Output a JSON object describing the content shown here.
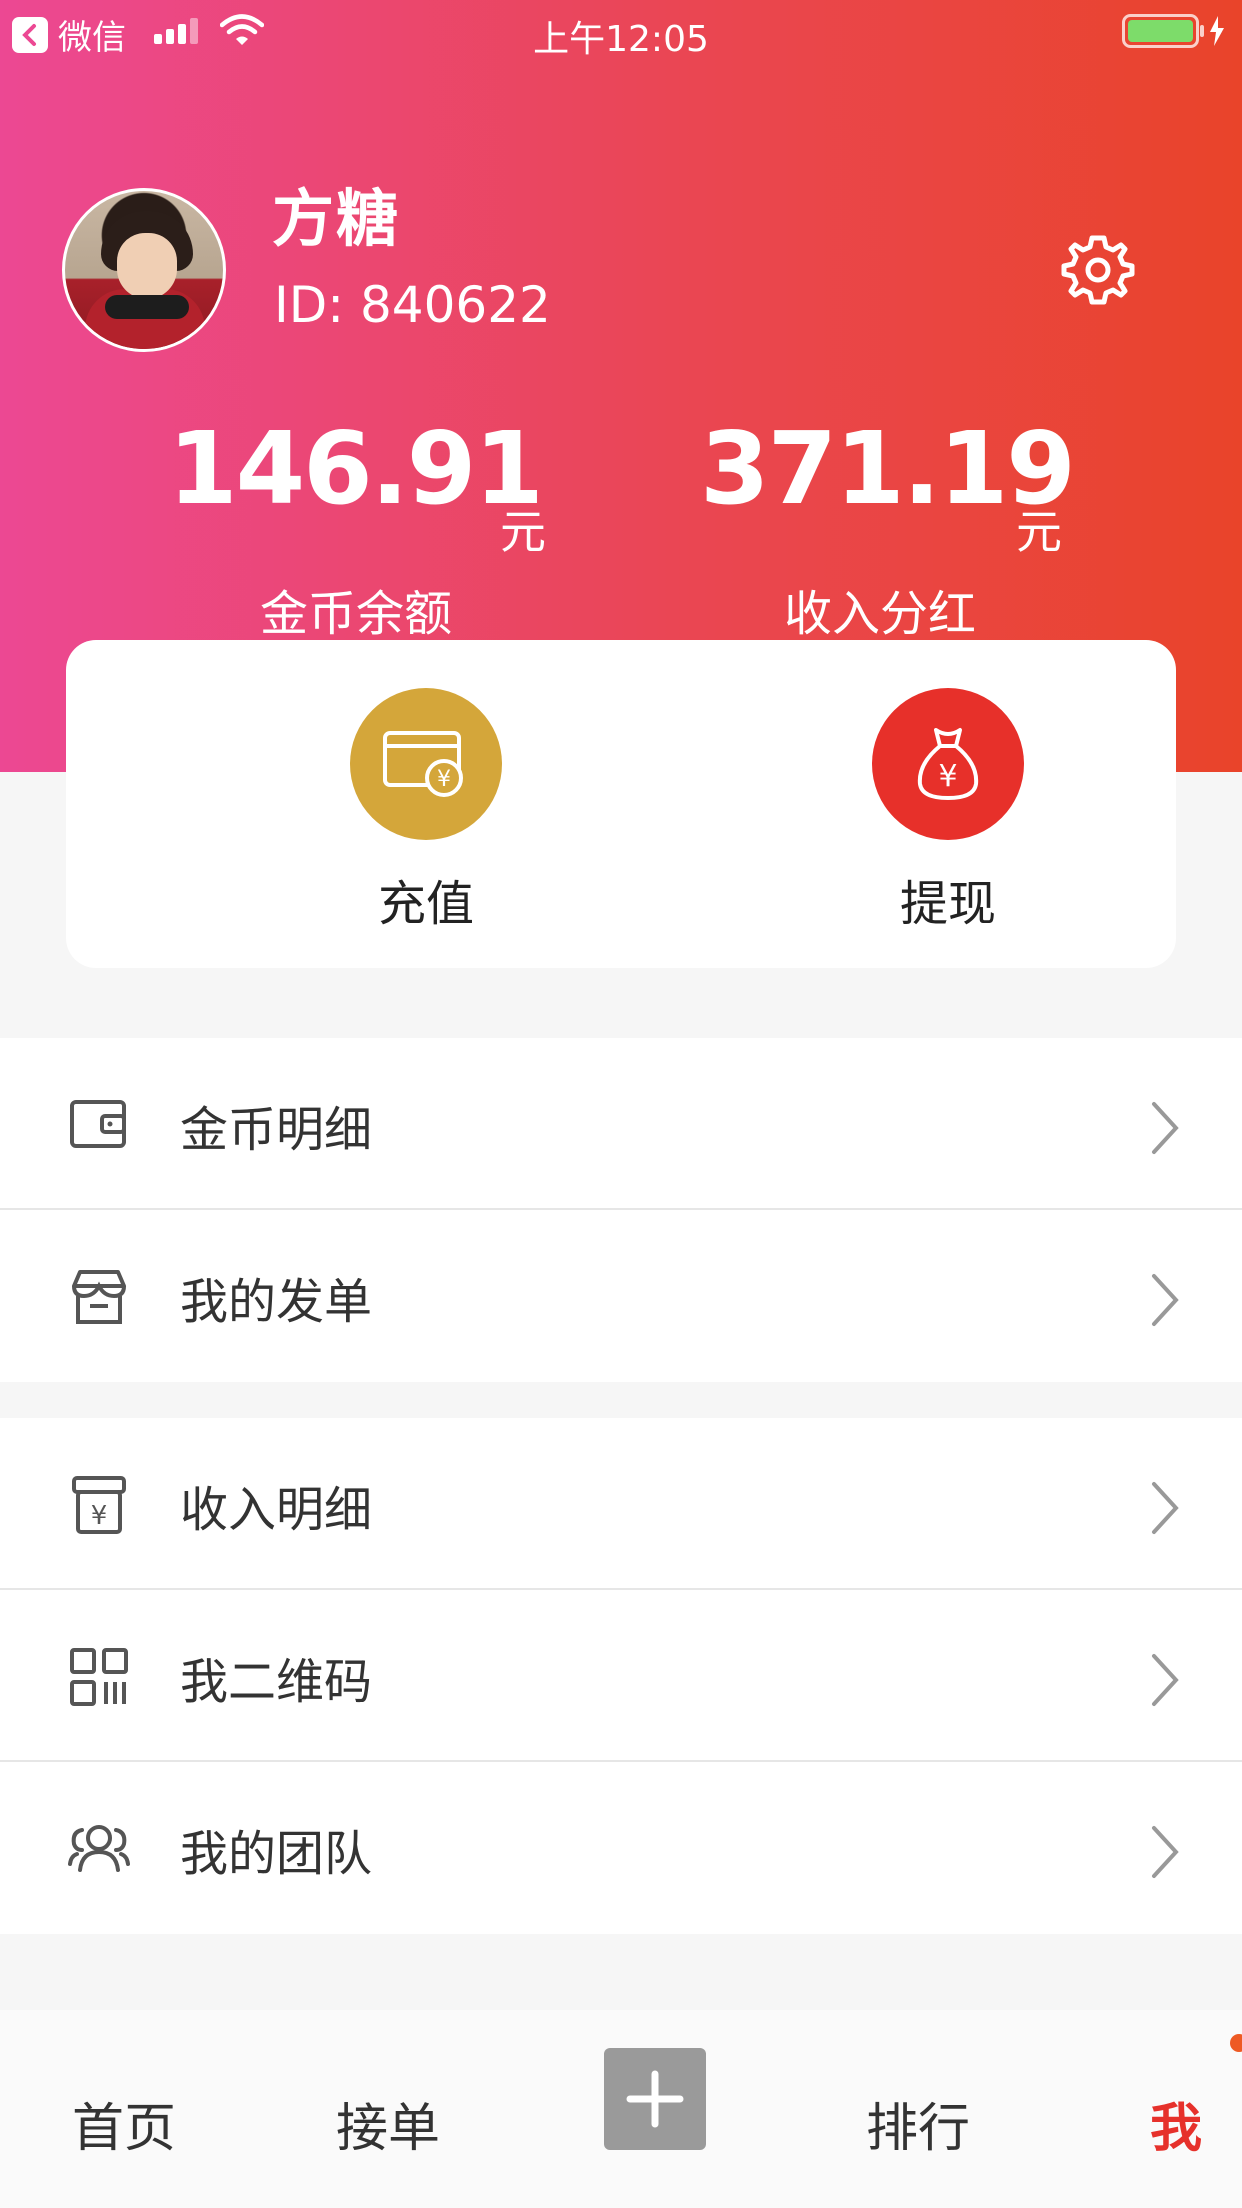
{
  "status_bar": {
    "back_app": "微信",
    "time": "上午12:05"
  },
  "profile": {
    "name": "方糖",
    "id_text": "ID: 840622"
  },
  "stats": {
    "coin_balance": {
      "value": "146.91",
      "unit": "元",
      "label": "金币余额"
    },
    "income_bonus": {
      "value": "371.19",
      "unit": "元",
      "label": "收入分红"
    }
  },
  "actions": {
    "recharge": {
      "label": "充值",
      "color": "#d4a63a"
    },
    "withdraw": {
      "label": "提现",
      "color": "#e7302a"
    }
  },
  "menu_group_1": [
    {
      "label": "金币明细",
      "icon": "wallet-icon"
    },
    {
      "label": "我的发单",
      "icon": "store-icon"
    }
  ],
  "menu_group_2": [
    {
      "label": "收入明细",
      "icon": "income-receipt-icon"
    },
    {
      "label": "我二维码",
      "icon": "qrcode-icon"
    },
    {
      "label": "我的团队",
      "icon": "team-icon"
    }
  ],
  "tab_bar": {
    "home": "首页",
    "orders": "接单",
    "ranking": "排行",
    "me": "我",
    "active_color": "#e6312b"
  },
  "colors": {
    "header_gradient_start": "#ec4893",
    "header_gradient_end": "#e9442a"
  }
}
